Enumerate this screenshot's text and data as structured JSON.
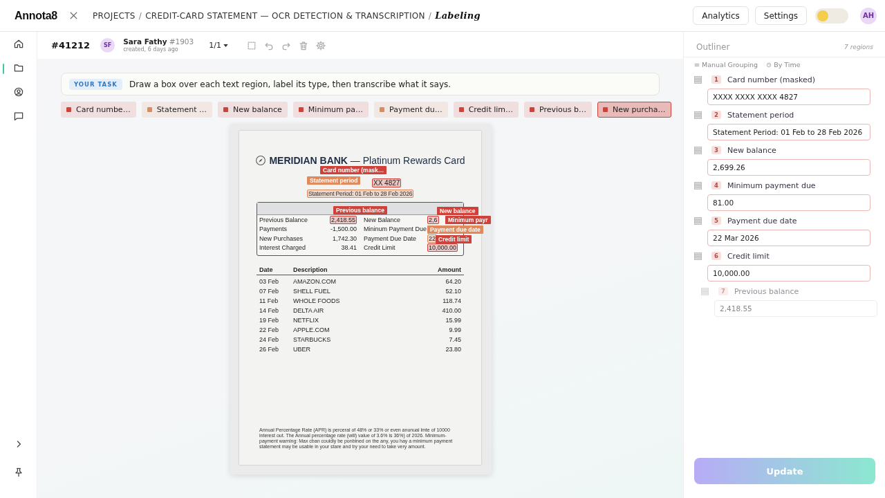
{
  "app": {
    "logo": "Annota8",
    "breadcrumb": [
      "PROJECTS",
      "CREDIT-CARD STATEMENT — OCR DETECTION & TRANSCRIPTION"
    ],
    "separator": "/",
    "page": "Labeling",
    "buttons": [
      "Analytics",
      "Settings"
    ],
    "theme_toggle": {
      "on": false
    },
    "user": {
      "initials": "AH"
    }
  },
  "sidebar": {
    "items": [
      {
        "kind": "home",
        "selected": false
      },
      {
        "kind": "folder",
        "selected": true
      },
      {
        "kind": "user",
        "selected": false
      },
      {
        "kind": "chat",
        "selected": false
      }
    ],
    "bottom": [
      {
        "kind": "chevron"
      },
      {
        "kind": "pin"
      }
    ]
  },
  "toolbar": {
    "task_id": "#41212",
    "annotator": {
      "initials": "SF",
      "name": "Sara Fathy",
      "id": "#1903",
      "created": "created, 6 days ago"
    },
    "pager": "1/1",
    "tools": [
      {
        "kind": "select"
      },
      {
        "kind": "undo"
      },
      {
        "kind": "redo"
      },
      {
        "kind": "trash"
      },
      {
        "kind": "gear"
      }
    ]
  },
  "task": {
    "badge": "YOUR TASK",
    "text": "Draw a box over each text region, label its type, then transcribe what it says."
  },
  "labels": [
    {
      "text": "Card numbe…",
      "color": "#d0413a",
      "selected": false
    },
    {
      "text": "Statement …",
      "color": "#e0895c",
      "selected": false
    },
    {
      "text": "New balance",
      "color": "#d0413a",
      "selected": false
    },
    {
      "text": "Minimum pa…",
      "color": "#d0413a",
      "selected": false
    },
    {
      "text": "Payment du…",
      "color": "#e0895c",
      "selected": false
    },
    {
      "text": "Credit lim…",
      "color": "#d0413a",
      "selected": false
    },
    {
      "text": "Previous b…",
      "color": "#d0413a",
      "selected": false
    },
    {
      "text": "New purcha…",
      "color": "#d0413a",
      "selected": true
    }
  ],
  "document": {
    "title": "**MERIDIAN BANK** — Platinum Rewards Card",
    "card_number": "XX 4827",
    "period": "Statement Period: 01 Feb to 28 Feb 2026",
    "summary": [
      {
        "label": "Previous Balance",
        "value": "2,418.55",
        "label_2": "New Balance",
        "value_2": "2,6"
      },
      {
        "label": "Payments",
        "value": "-1,500.00",
        "label_2": "Mininum Payment Due"
      },
      {
        "label": "New Purchases",
        "value": "1,742.30",
        "label_2": "Payment Due Date",
        "value_2": "22"
      },
      {
        "label": "Interest Charged",
        "value": "38.41",
        "label_2": "Credit Limit",
        "value_2": "10,000.00"
      }
    ],
    "transactions": {
      "columns": [
        "Date",
        "Description",
        "Amount"
      ],
      "rows": [
        [
          "03 Feb",
          "AMAZON.COM",
          "64.20"
        ],
        [
          "07 Feb",
          "SHELL FUEL",
          "52.10"
        ],
        [
          "11 Feb",
          "WHOLE FOODS",
          "118.74"
        ],
        [
          "14 Feb",
          "DELTA AIR",
          "410.00"
        ],
        [
          "19 Feb",
          "NETFLIX",
          "15.99"
        ],
        [
          "22 Feb",
          "APPLE.COM",
          "9.99"
        ],
        [
          "24 Feb",
          "STARBUCKS",
          "7.45"
        ],
        [
          "26 Feb",
          "UBER",
          "23.80"
        ]
      ]
    },
    "footnote": "Annual Percentage Rate (APR) is perceral of 48% or 33% or even anunual lmte of 10000 interest out. The Annual percentage rate (will) value of 3.6% is 36%) of 2026. Minimum-payment warning: Max cban couldly be ponbined on the any, you hay a minimum payment statement may be usable in your stare and try your need to take very amount.",
    "annotations": [
      {
        "label": "Card number (mask…",
        "color": "#d0413a"
      },
      {
        "label": "Statement period",
        "color": "#e0895c"
      },
      {
        "label": "Previous balance",
        "color": "#d0413a"
      },
      {
        "label": "New balance",
        "color": "#d0413a"
      },
      {
        "label": "Minimum payr",
        "color": "#d0413a"
      },
      {
        "label": "Payment due date",
        "color": "#e0895c"
      },
      {
        "label": "Credit limit",
        "color": "#d0413a"
      }
    ]
  },
  "outliner": {
    "title": "Outliner",
    "count": "7 regions",
    "grouping": [
      "Manual Grouping",
      "By Time"
    ],
    "regions": [
      {
        "number": "1",
        "label": "Card number (masked)",
        "value": "XXXX XXXX XXXX 4827",
        "faded": false
      },
      {
        "number": "2",
        "label": "Statement period",
        "value": "Statement Period: 01 Feb to 28 Feb 2026",
        "faded": false
      },
      {
        "number": "3",
        "label": "New balance",
        "value": "2,699.26",
        "faded": false
      },
      {
        "number": "4",
        "label": "Minimum payment due",
        "value": "81.00",
        "faded": false
      },
      {
        "number": "5",
        "label": "Payment due date",
        "value": "22 Mar 2026",
        "faded": false
      },
      {
        "number": "6",
        "label": "Credit limit",
        "value": "10,000.00",
        "faded": false
      },
      {
        "number": "7",
        "label": "Previous balance",
        "value": "2,418.55",
        "faded": true
      }
    ]
  },
  "update_button": "Update"
}
